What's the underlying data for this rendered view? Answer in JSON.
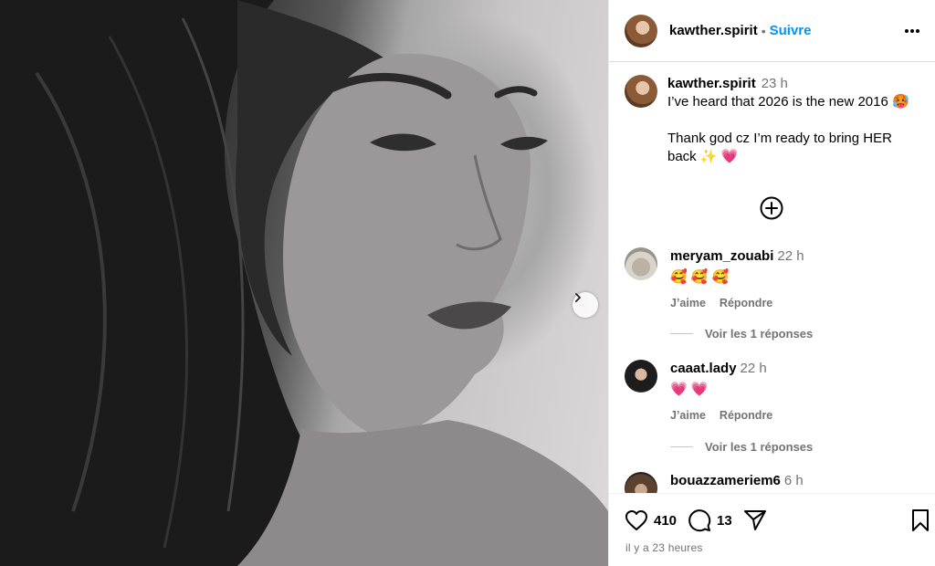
{
  "post": {
    "username": "kawther.spirit",
    "follow_label": "Suivre",
    "separator": "•",
    "caption_time": "23 h",
    "caption_text": "I’ve heard that 2026 is the new 2016 🥵\n\nThank god cz I’m ready to bring HER back ✨ 💗",
    "likes": "410",
    "comments_count": "13",
    "posted_ago": "il y a 23 heures"
  },
  "comments": [
    {
      "username": "meryam_zouabi",
      "time": "22 h",
      "text": "🥰 🥰 🥰",
      "like_label": "J’aime",
      "reply_label": "Répondre",
      "view_replies": "Voir les 1 réponses"
    },
    {
      "username": "caaat.lady",
      "time": "22 h",
      "text": "💗 💗",
      "like_label": "J’aime",
      "reply_label": "Répondre",
      "view_replies": "Voir les 1 réponses"
    },
    {
      "username": "bouazzameriem6",
      "time": "6 h"
    }
  ],
  "icons": {
    "more": "more-horizontal-icon",
    "add": "plus-circle-icon",
    "like": "heart-icon",
    "comment": "comment-icon",
    "share": "send-icon",
    "save": "bookmark-icon",
    "next": "chevron-right-icon"
  },
  "colors": {
    "follow": "#0095f6",
    "muted": "#737373"
  }
}
